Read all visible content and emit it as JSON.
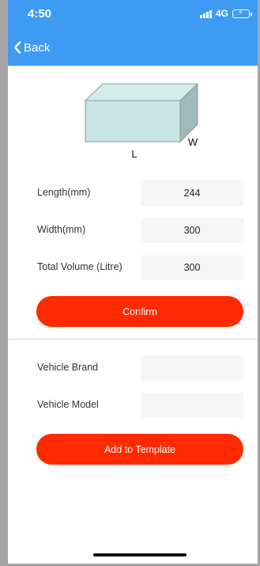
{
  "status_bar": {
    "time": "4:50",
    "network": "4G"
  },
  "nav": {
    "back_label": "Back"
  },
  "diagram": {
    "length_label": "L",
    "width_label": "W"
  },
  "dimensions": [
    {
      "label": "Length(mm)",
      "value": "244"
    },
    {
      "label": "Width(mm)",
      "value": "300"
    },
    {
      "label": "Total Volume (Litre)",
      "value": "300"
    }
  ],
  "confirm_label": "Confirm",
  "vehicle": [
    {
      "label": "Vehicle Brand",
      "value": ""
    },
    {
      "label": "Vehicle Model",
      "value": ""
    }
  ],
  "add_template_label": "Add to Template",
  "colors": {
    "header": "#3e9bf3",
    "accent": "#ff2a00",
    "field_bg": "#f6f6f6",
    "box_face": "#c8e4e3"
  }
}
